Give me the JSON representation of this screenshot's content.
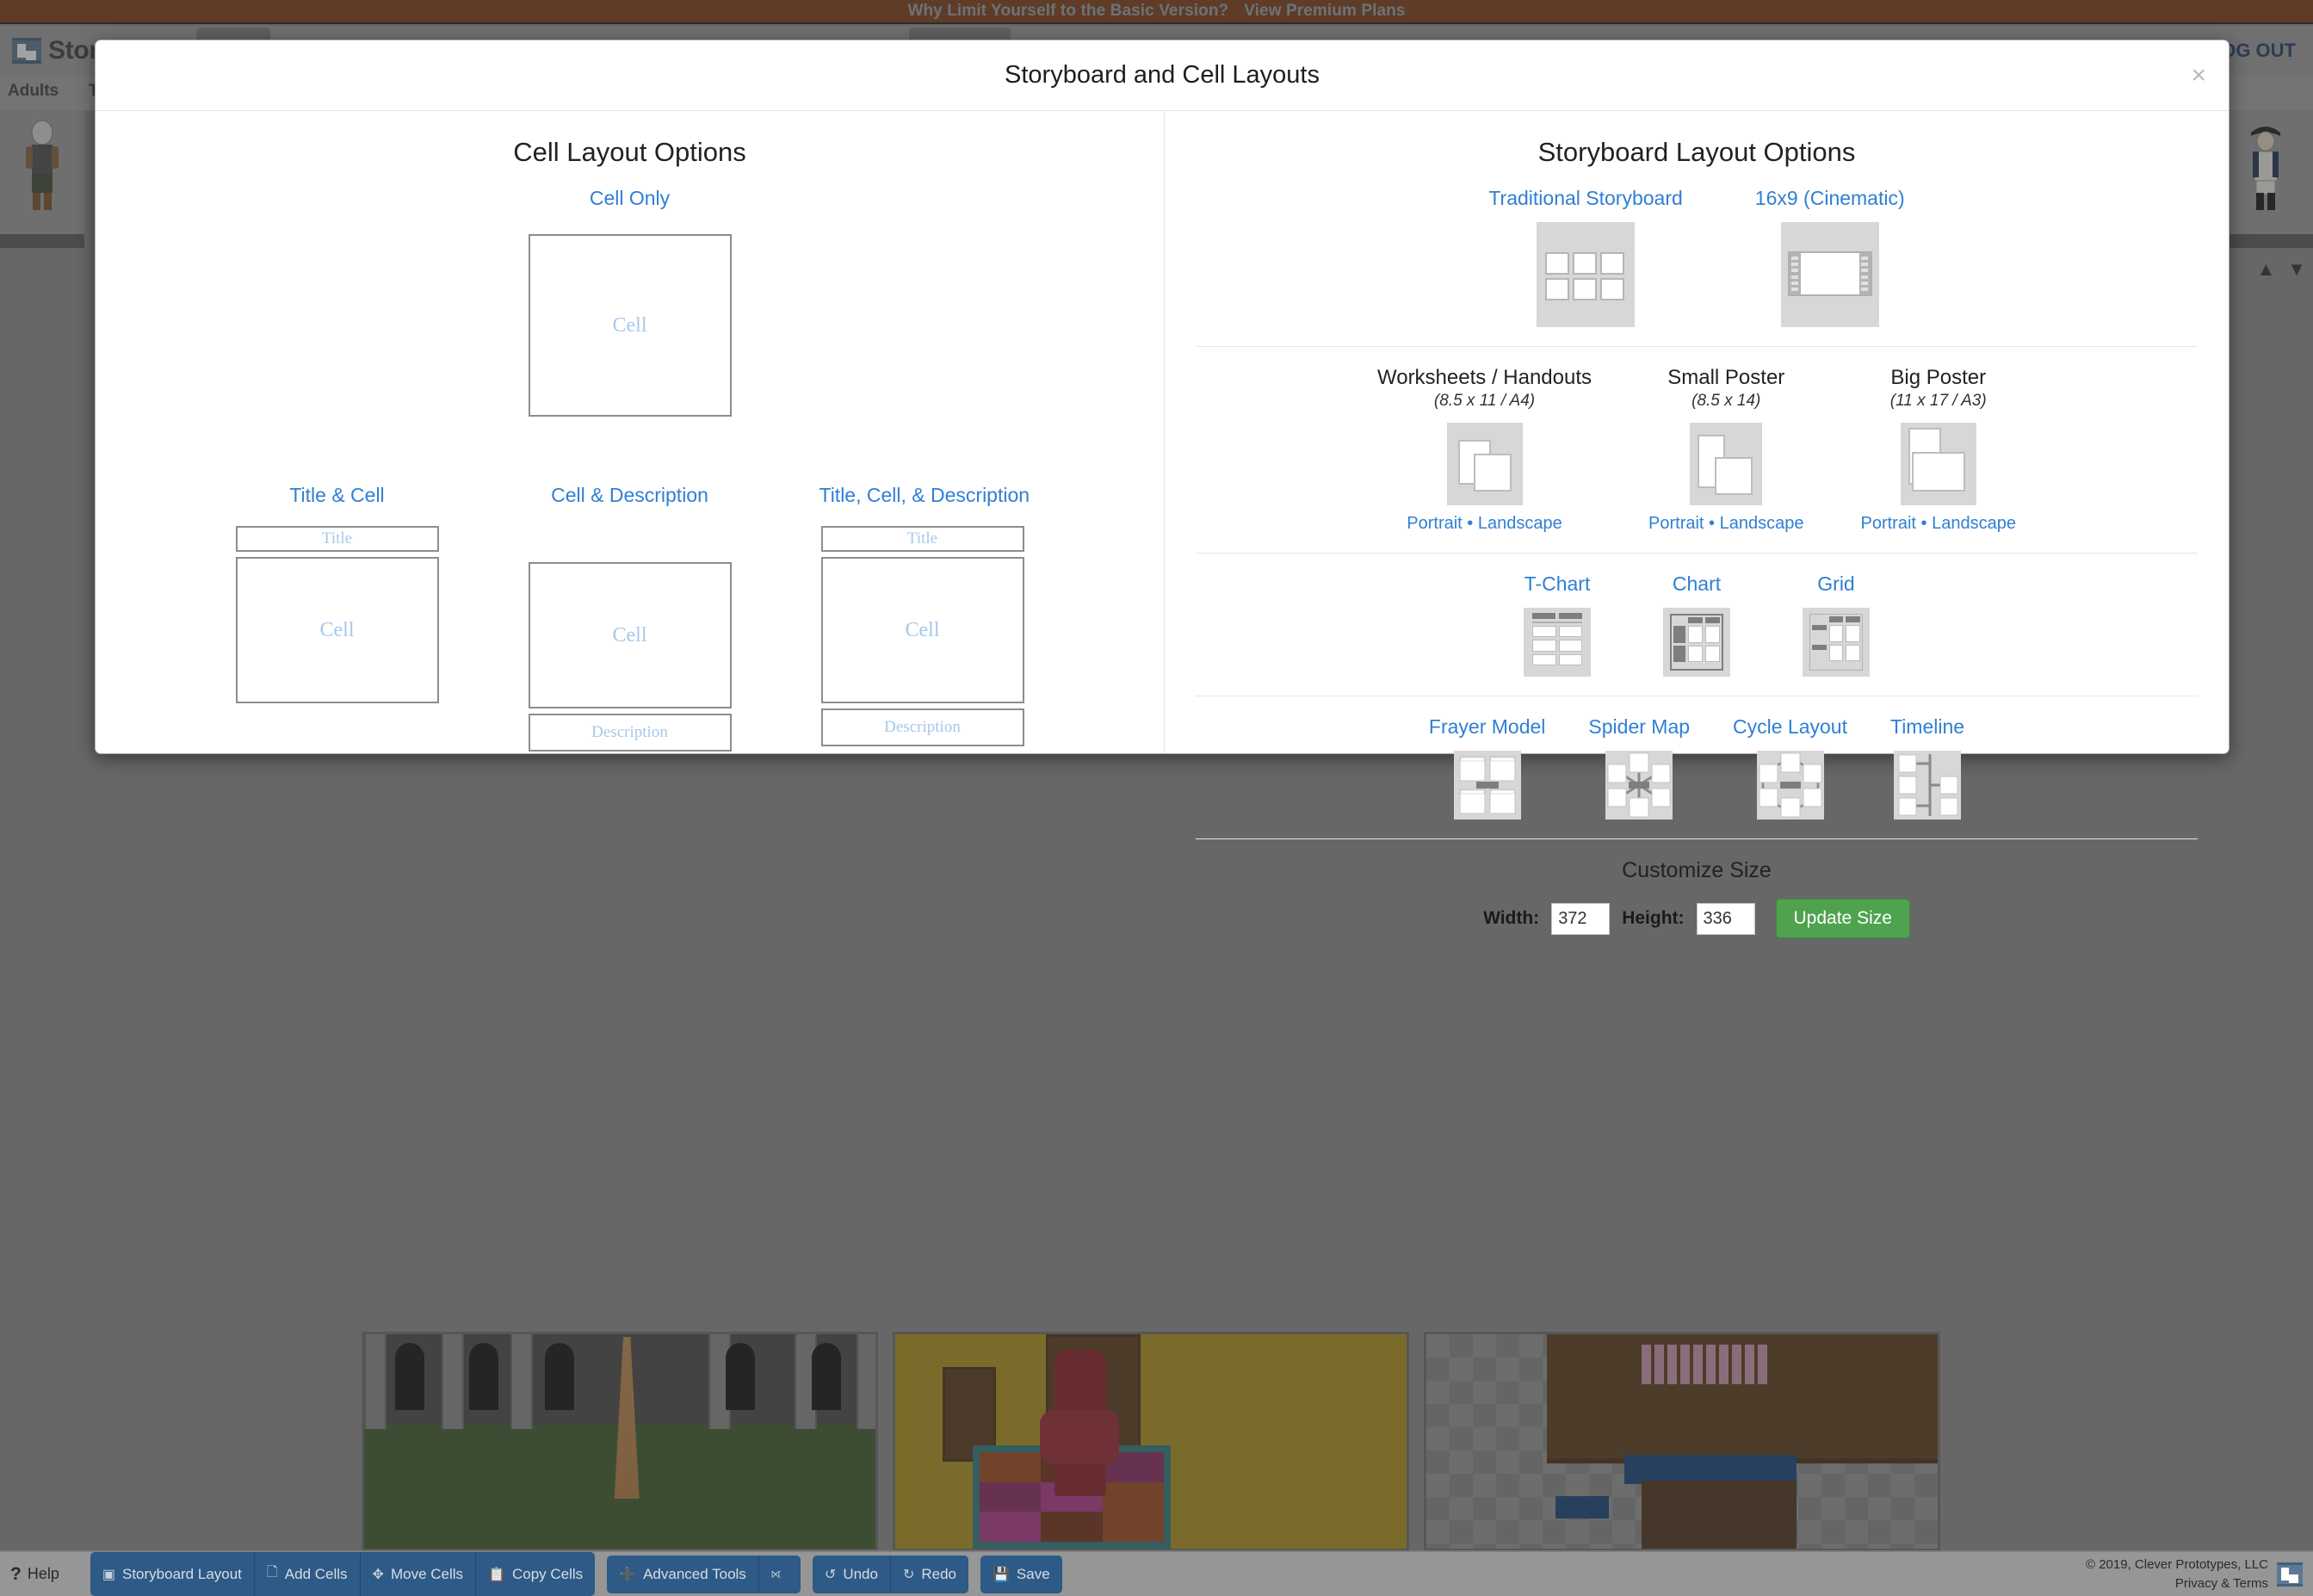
{
  "promo": {
    "message": "Why Limit Yourself to the Basic Version?",
    "cta": "View Premium Plans"
  },
  "app": {
    "brand": "Storyboard That",
    "logout": "LOG OUT",
    "tabs": [
      "Adults",
      "Teens"
    ]
  },
  "modal": {
    "title": "Storyboard and Cell Layouts",
    "close_icon": "×",
    "left": {
      "heading": "Cell Layout Options",
      "cell_only": {
        "label": "Cell Only",
        "cell_text": "Cell"
      },
      "options": [
        {
          "label": "Title & Cell",
          "title_text": "Title",
          "cell_text": "Cell",
          "desc_text": null
        },
        {
          "label": "Cell & Description",
          "title_text": null,
          "cell_text": "Cell",
          "desc_text": "Description"
        },
        {
          "label": "Title, Cell, & Description",
          "title_text": "Title",
          "cell_text": "Cell",
          "desc_text": "Description"
        }
      ]
    },
    "right": {
      "heading": "Storyboard Layout Options",
      "row_primary": [
        {
          "label": "Traditional Storyboard"
        },
        {
          "label": "16x9 (Cinematic)"
        }
      ],
      "row_paper": [
        {
          "label": "Worksheets / Handouts",
          "dimensions": "(8.5 x 11 / A4)",
          "portrait": "Portrait",
          "sep": "•",
          "landscape": "Landscape"
        },
        {
          "label": "Small Poster",
          "dimensions": "(8.5 x 14)",
          "portrait": "Portrait",
          "sep": "•",
          "landscape": "Landscape"
        },
        {
          "label": "Big Poster",
          "dimensions": "(11 x 17 / A3)",
          "portrait": "Portrait",
          "sep": "•",
          "landscape": "Landscape"
        }
      ],
      "row_charts": [
        {
          "label": "T-Chart"
        },
        {
          "label": "Chart"
        },
        {
          "label": "Grid"
        }
      ],
      "row_diagrams": [
        {
          "label": "Frayer Model"
        },
        {
          "label": "Spider Map"
        },
        {
          "label": "Cycle Layout"
        },
        {
          "label": "Timeline"
        }
      ],
      "customize": {
        "title": "Customize Size",
        "width_label": "Width:",
        "width_value": "372",
        "height_label": "Height:",
        "height_value": "336",
        "button": "Update Size"
      }
    }
  },
  "toolbar": {
    "help": "Help",
    "buttons": [
      {
        "label": "Storyboard Layout",
        "icon": "layout-icon"
      },
      {
        "label": "Add Cells",
        "icon": "add-cell-icon"
      },
      {
        "label": "Move Cells",
        "icon": "move-icon"
      },
      {
        "label": "Copy Cells",
        "icon": "copy-icon"
      },
      {
        "label": "Advanced Tools",
        "icon": "plus-icon"
      },
      {
        "label": "",
        "icon": "fullscreen-icon"
      },
      {
        "label": "Undo",
        "icon": "undo-icon"
      },
      {
        "label": "Redo",
        "icon": "redo-icon"
      },
      {
        "label": "Save",
        "icon": "save-icon"
      }
    ],
    "copyright": "© 2019, Clever Prototypes, LLC",
    "privacy": "Privacy & Terms"
  },
  "colors": {
    "promo_bg": "#7d3d16",
    "link_blue": "#2f7fd4",
    "toolbar_blue": "#2d5a87",
    "green_button": "#4fa34f",
    "thumb_gray": "#d7d7d7",
    "placeholder_blue": "#a6c8ec"
  }
}
